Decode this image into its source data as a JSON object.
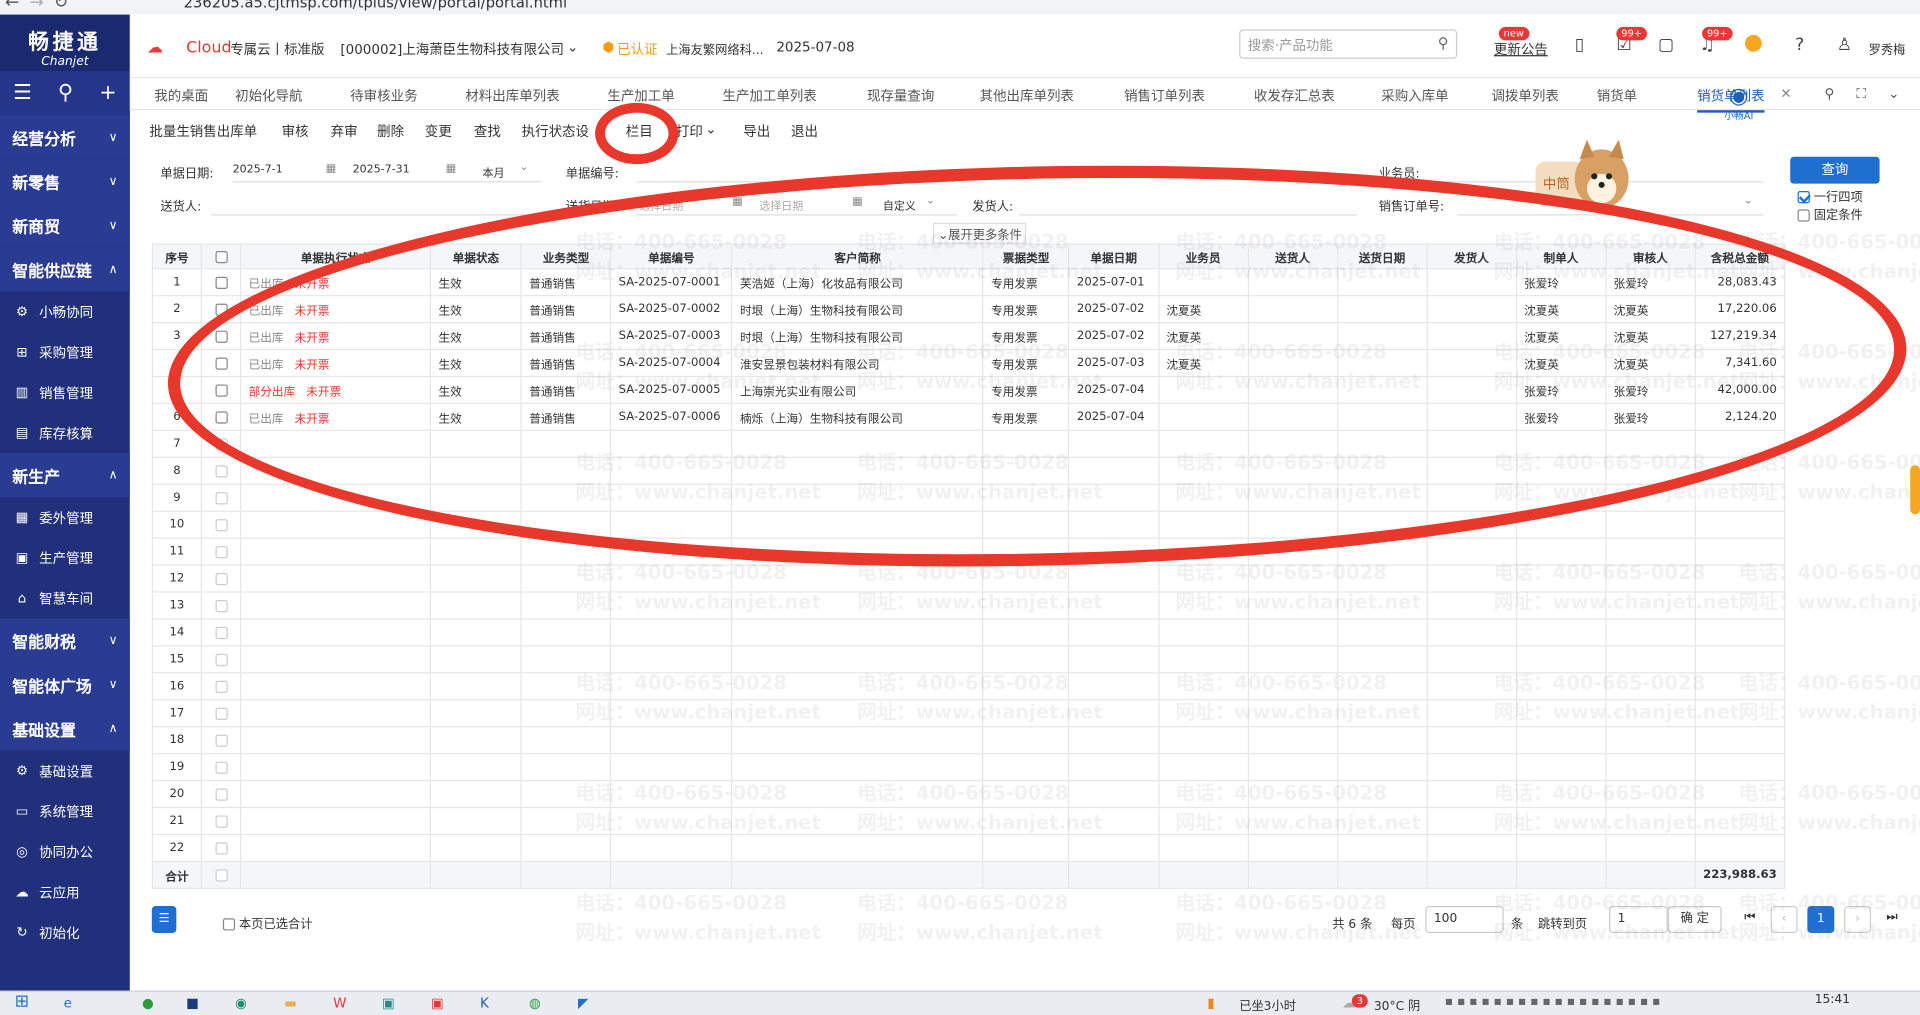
{
  "browser": {
    "url": "236205.a5.cjtmsp.com/tplus/view/portal/portal.html"
  },
  "sidebar": {
    "brand": "畅捷通",
    "brand_sub": "Chanjet",
    "groups": [
      {
        "label": "经营分析",
        "chev": "∨"
      },
      {
        "label": "新零售",
        "chev": "∨"
      },
      {
        "label": "新商贸",
        "chev": "∨"
      },
      {
        "label": "智能供应链",
        "chev": "∧"
      }
    ],
    "supply_items": [
      "小畅协同",
      "采购管理",
      "销售管理",
      "库存核算"
    ],
    "group_production": {
      "label": "新生产",
      "chev": "∧"
    },
    "production_items": [
      "委外管理",
      "生产管理",
      "智慧车间"
    ],
    "group_finance": {
      "label": "智能财税",
      "chev": "∨"
    },
    "group_agent": {
      "label": "智能体广场",
      "chev": "∨"
    },
    "group_base": {
      "label": "基础设置",
      "chev": "∧"
    },
    "base_items": [
      "基础设置",
      "系统管理",
      "协同办公",
      "云应用",
      "初始化"
    ]
  },
  "topbar": {
    "cloud": "Cloud",
    "edition": "专属云丨标准版",
    "company": "[000002]上海萧臣生物科技有限公司",
    "certified": "已认证",
    "cert_company": "上海友繁网络科...",
    "date": "2025-07-08",
    "search_placeholder": "搜索·产品功能",
    "new_badge": "new",
    "update_link": "更新公告",
    "badge1": "99+",
    "badge2": "99+",
    "user": "罗秀梅"
  },
  "tabs": [
    "我的桌面",
    "初始化导航",
    "待审核业务",
    "材料出库单列表",
    "生产加工单",
    "生产加工单列表",
    "现存量查询",
    "其他出库单列表",
    "销售订单列表",
    "收发存汇总表",
    "采购入库单",
    "调拨单列表",
    "销货单",
    "销货单列表"
  ],
  "ai_label": "小畅AI",
  "actions": [
    "批量生销售出库单",
    "审核",
    "弃审",
    "删除",
    "变更",
    "查找",
    "执行状态设",
    "栏目",
    "打印",
    "导出",
    "退出"
  ],
  "filters": {
    "date_label": "单据日期:",
    "date_from": "2025-7-1",
    "date_to": "2025-7-31",
    "period": "本月",
    "doc_no_label": "单据编号:",
    "salesman_label": "业务员:",
    "deliverer_label": "送货人:",
    "delivery_date_label": "送货日期:",
    "pick_date": "选择日期",
    "custom": "自定义",
    "shipper_label": "发货人:",
    "so_label": "销售订单号:",
    "query_btn": "查询",
    "one_row": "一行四项",
    "fixed": "固定条件",
    "expand": "展开更多条件"
  },
  "columns": [
    "序号",
    "单据执行状态",
    "单据状态",
    "业务类型",
    "单据编号",
    "客户简称",
    "票据类型",
    "单据日期",
    "业务员",
    "送货人",
    "送货日期",
    "发货人",
    "制单人",
    "审核人",
    "含税总金额"
  ],
  "rows": [
    {
      "no": "1",
      "status1": "已出库",
      "status2": "未开票",
      "state": "生效",
      "biz": "普通销售",
      "code": "SA-2025-07-0001",
      "customer": "芙浩姬（上海）化妆品有限公司",
      "invoice": "专用发票",
      "date": "2025-07-01",
      "salesman": "",
      "maker": "张爱玲",
      "auditor": "张爱玲",
      "amount": "28,083.43"
    },
    {
      "no": "2",
      "status1": "已出库",
      "status2": "未开票",
      "state": "生效",
      "biz": "普通销售",
      "code": "SA-2025-07-0002",
      "customer": "时垠（上海）生物科技有限公司",
      "invoice": "专用发票",
      "date": "2025-07-02",
      "salesman": "沈夏英",
      "maker": "沈夏英",
      "auditor": "沈夏英",
      "amount": "17,220.06"
    },
    {
      "no": "3",
      "status1": "已出库",
      "status2": "未开票",
      "state": "生效",
      "biz": "普通销售",
      "code": "SA-2025-07-0003",
      "customer": "时垠（上海）生物科技有限公司",
      "invoice": "专用发票",
      "date": "2025-07-02",
      "salesman": "沈夏英",
      "maker": "沈夏英",
      "auditor": "沈夏英",
      "amount": "127,219.34"
    },
    {
      "no": "4",
      "status1": "已出库",
      "status2": "未开票",
      "state": "生效",
      "biz": "普通销售",
      "code": "SA-2025-07-0004",
      "customer": "淮安昱景包装材料有限公司",
      "invoice": "专用发票",
      "date": "2025-07-03",
      "salesman": "沈夏英",
      "maker": "沈夏英",
      "auditor": "沈夏英",
      "amount": "7,341.60"
    },
    {
      "no": "5",
      "status1": "部分出库",
      "status2": "未开票",
      "state": "生效",
      "biz": "普通销售",
      "code": "SA-2025-07-0005",
      "customer": "上海崇光实业有限公司",
      "invoice": "专用发票",
      "date": "2025-07-04",
      "salesman": "",
      "maker": "张爱玲",
      "auditor": "张爱玲",
      "amount": "42,000.00"
    },
    {
      "no": "6",
      "status1": "已出库",
      "status2": "未开票",
      "state": "生效",
      "biz": "普通销售",
      "code": "SA-2025-07-0006",
      "customer": "楠烁（上海）生物科技有限公司",
      "invoice": "专用发票",
      "date": "2025-07-04",
      "salesman": "",
      "maker": "张爱玲",
      "auditor": "张爱玲",
      "amount": "2,124.20"
    }
  ],
  "empty_rows": [
    "7",
    "8",
    "9",
    "10",
    "11",
    "12",
    "13",
    "14",
    "15",
    "16",
    "17",
    "18",
    "19",
    "20",
    "21",
    "22"
  ],
  "total": {
    "label": "合计",
    "amount": "223,988.63"
  },
  "pager": {
    "page_selected": "本页已选合计",
    "count": "共 6 条",
    "per_page": "每页",
    "per_value": "100",
    "unit": "条",
    "jump": "跳转到页",
    "jump_value": "1",
    "confirm": "确 定",
    "current": "1"
  },
  "watermark": {
    "phone": "电话：400-665-0028",
    "site": "网址：www.chanjet.net"
  },
  "mascot": "中筒",
  "taskbar": {
    "sitting": "已坐3小时",
    "weather": "30°C 阴",
    "time": "15:41",
    "notif": "3"
  },
  "colors": {
    "sidebar": "#20307a",
    "accent": "#1f6fd0",
    "red": "#e53935",
    "annotation": "#e8382c"
  }
}
